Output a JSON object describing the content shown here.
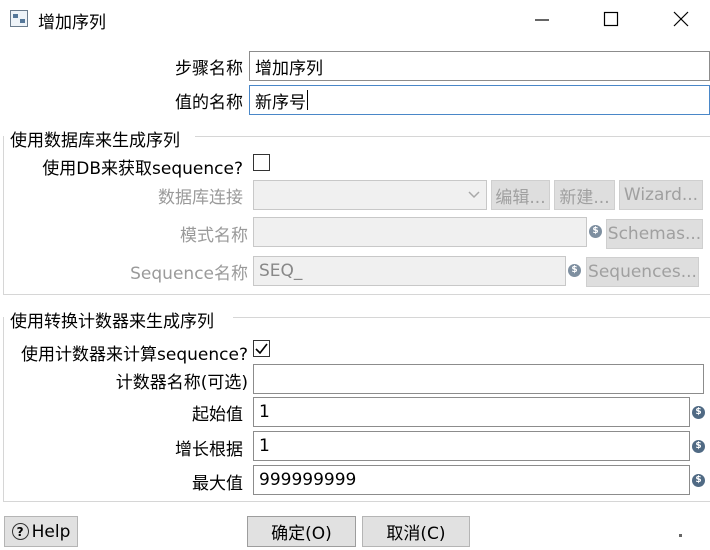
{
  "window": {
    "title": "增加序列"
  },
  "step": {
    "name_label": "步骤名称",
    "name_value": "增加序列",
    "value_name_label": "值的名称",
    "value_name_value": "新序号"
  },
  "db_group": {
    "title": "使用数据库来生成序列",
    "use_db_label": "使用DB来获取sequence?",
    "use_db_checked": false,
    "connection_label": "数据库连接",
    "connection_value": "",
    "edit_button": "编辑...",
    "new_button": "新建...",
    "wizard_button": "Wizard...",
    "schema_label": "模式名称",
    "schema_value": "",
    "schemas_button": "Schemas...",
    "sequence_label": "Sequence名称",
    "sequence_value": "SEQ_",
    "sequences_button": "Sequences..."
  },
  "counter_group": {
    "title": "使用转换计数器来生成序列",
    "use_counter_label": "使用计数器来计算sequence?",
    "use_counter_checked": true,
    "counter_name_label": "计数器名称(可选)",
    "counter_name_value": "",
    "start_label": "起始值",
    "start_value": "1",
    "increment_label": "增长根据",
    "increment_value": "1",
    "max_label": "最大值",
    "max_value": "999999999"
  },
  "footer": {
    "help_button": "Help",
    "ok_button": "确定(O)",
    "cancel_button": "取消(C)"
  }
}
